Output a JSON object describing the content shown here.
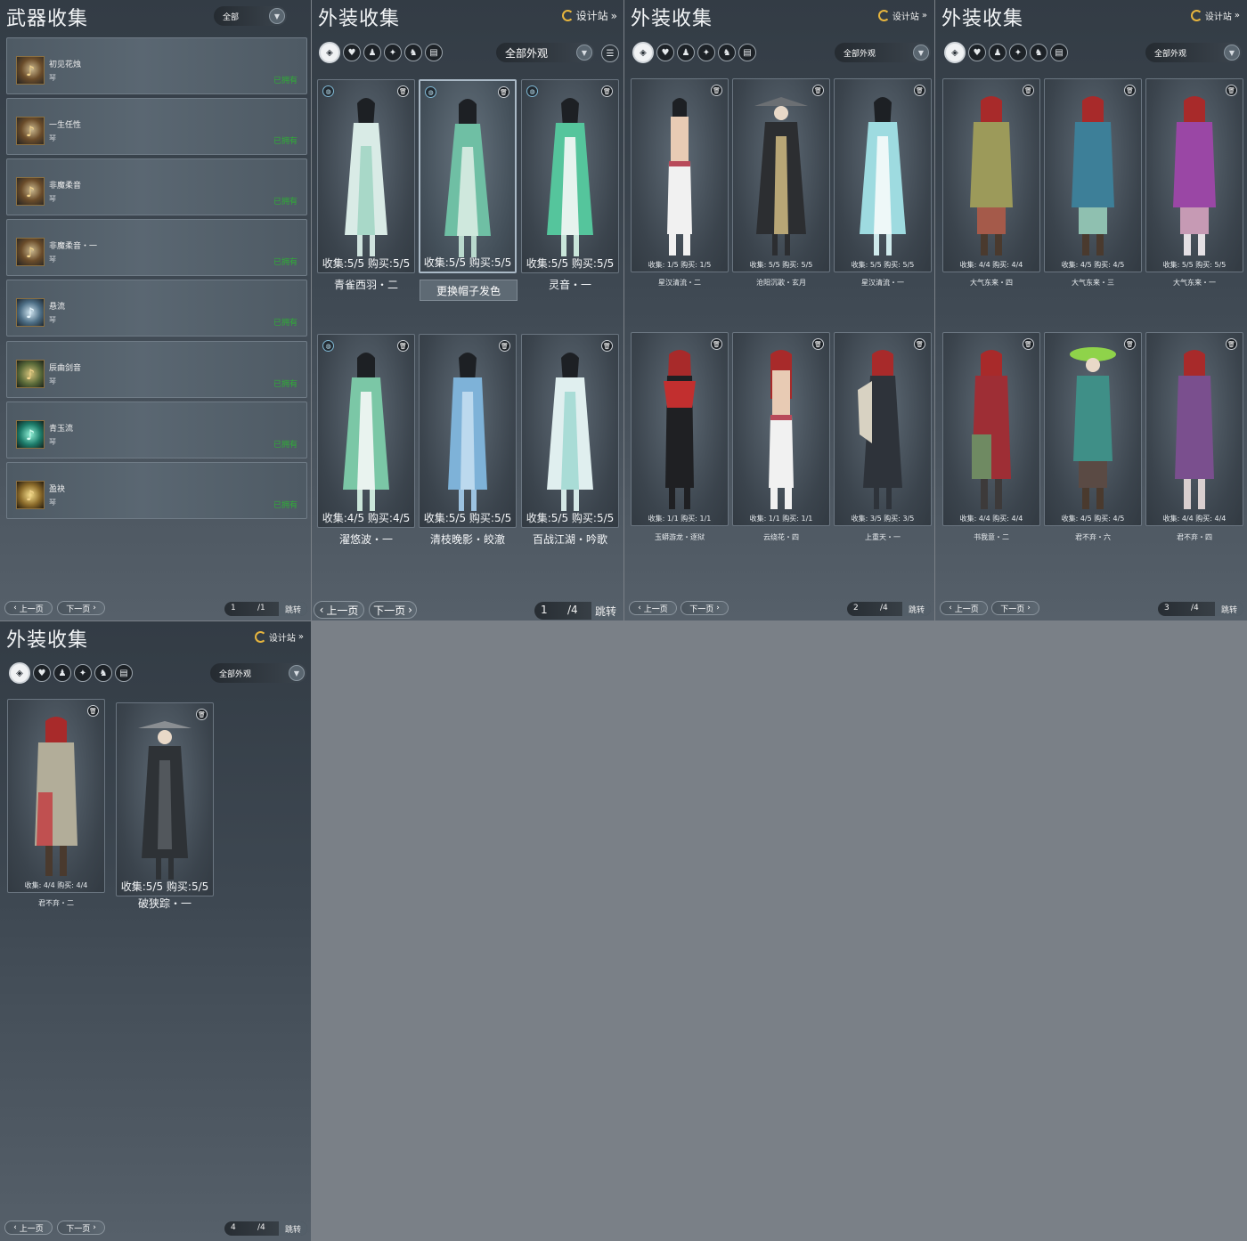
{
  "weapon_panel": {
    "title": "武器收集",
    "filter": "全部",
    "items": [
      {
        "name": "初见花烛",
        "type": "琴",
        "status": "已拥有"
      },
      {
        "name": "一生任性",
        "type": "琴",
        "status": "已拥有"
      },
      {
        "name": "非魔柔音",
        "type": "琴",
        "status": "已拥有"
      },
      {
        "name": "非魔柔音・一",
        "type": "琴",
        "status": "已拥有"
      },
      {
        "name": "悬流",
        "type": "琴",
        "status": "已拥有"
      },
      {
        "name": "辰曲剑音",
        "type": "琴",
        "status": "已拥有"
      },
      {
        "name": "青玉流",
        "type": "琴",
        "status": "已拥有"
      },
      {
        "name": "盈袂",
        "type": "琴",
        "status": "已拥有"
      }
    ],
    "pager": {
      "prev": "上一页",
      "next": "下一页",
      "current": "1",
      "total": "/1",
      "jump": "跳转"
    }
  },
  "outfit_panel_1": {
    "title": "外装收集",
    "design_site": "设计站",
    "filter": "全部外观",
    "tooltip": "更换帽子发色",
    "cards": [
      {
        "stats": "收集:5/5 购买:5/5",
        "name": "青雀西羽・二"
      },
      {
        "stats": "收集:5/5 购买:5/5",
        "name": ""
      },
      {
        "stats": "收集:5/5 购买:5/5",
        "name": "灵音・一"
      },
      {
        "stats": "收集:4/5 购买:4/5",
        "name": "濯悠波・一"
      },
      {
        "stats": "收集:5/5 购买:5/5",
        "name": "清枝晚影・皎澈"
      },
      {
        "stats": "收集:5/5 购买:5/5",
        "name": "百战江湖・吟歌"
      }
    ],
    "pager": {
      "prev": "上一页",
      "next": "下一页",
      "current": "1",
      "total": "/4",
      "jump": "跳转"
    }
  },
  "outfit_panel_2": {
    "title": "外装收集",
    "design_site": "设计站",
    "filter": "全部外观",
    "cards": [
      {
        "stats": "收集: 1/5 购买: 1/5",
        "name": "星汉清流・二"
      },
      {
        "stats": "收集: 5/5 购买: 5/5",
        "name": "沧阳沉歌・玄月"
      },
      {
        "stats": "收集: 5/5 购买: 5/5",
        "name": "星汉清流・一"
      },
      {
        "stats": "收集: 1/1 购买: 1/1",
        "name": "玉蟒游龙・逐狱"
      },
      {
        "stats": "收集: 1/1 购买: 1/1",
        "name": "云绕花・四"
      },
      {
        "stats": "收集: 3/5 购买: 3/5",
        "name": "上重天・一"
      }
    ],
    "pager": {
      "prev": "上一页",
      "next": "下一页",
      "current": "2",
      "total": "/4",
      "jump": "跳转"
    }
  },
  "outfit_panel_3": {
    "title": "外装收集",
    "design_site": "设计站",
    "filter": "全部外观",
    "cards": [
      {
        "stats": "收集: 4/4 购买: 4/4",
        "name": "大气东来・四"
      },
      {
        "stats": "收集: 4/5 购买: 4/5",
        "name": "大气东来・三"
      },
      {
        "stats": "收集: 5/5 购买: 5/5",
        "name": "大气东来・一"
      },
      {
        "stats": "收集: 4/4 购买: 4/4",
        "name": "书我意・二"
      },
      {
        "stats": "收集: 4/5 购买: 4/5",
        "name": "君不弃・六"
      },
      {
        "stats": "收集: 4/4 购买: 4/4",
        "name": "君不弃・四"
      }
    ],
    "pager": {
      "prev": "上一页",
      "next": "下一页",
      "current": "3",
      "total": "/4",
      "jump": "跳转"
    }
  },
  "outfit_panel_4": {
    "title": "外装收集",
    "design_site": "设计站",
    "filter": "全部外观",
    "cards": [
      {
        "stats": "收集: 4/4 购买: 4/4",
        "name": "君不弃・二"
      },
      {
        "stats": "收集:5/5 购买:5/5",
        "name": "破狭踪・一"
      }
    ],
    "pager": {
      "prev": "上一页",
      "next": "下一页",
      "current": "4",
      "total": "/4",
      "jump": "跳转"
    }
  },
  "colors": {
    "owned_green": "#2fae36",
    "panel_dark": "#333c45",
    "accent_gold": "#e7b53e"
  },
  "icons": [
    "trash-icon",
    "hat-dye-icon",
    "moon-icon",
    "chevron-down-icon",
    "sort-filter-icon",
    "category-icons"
  ]
}
